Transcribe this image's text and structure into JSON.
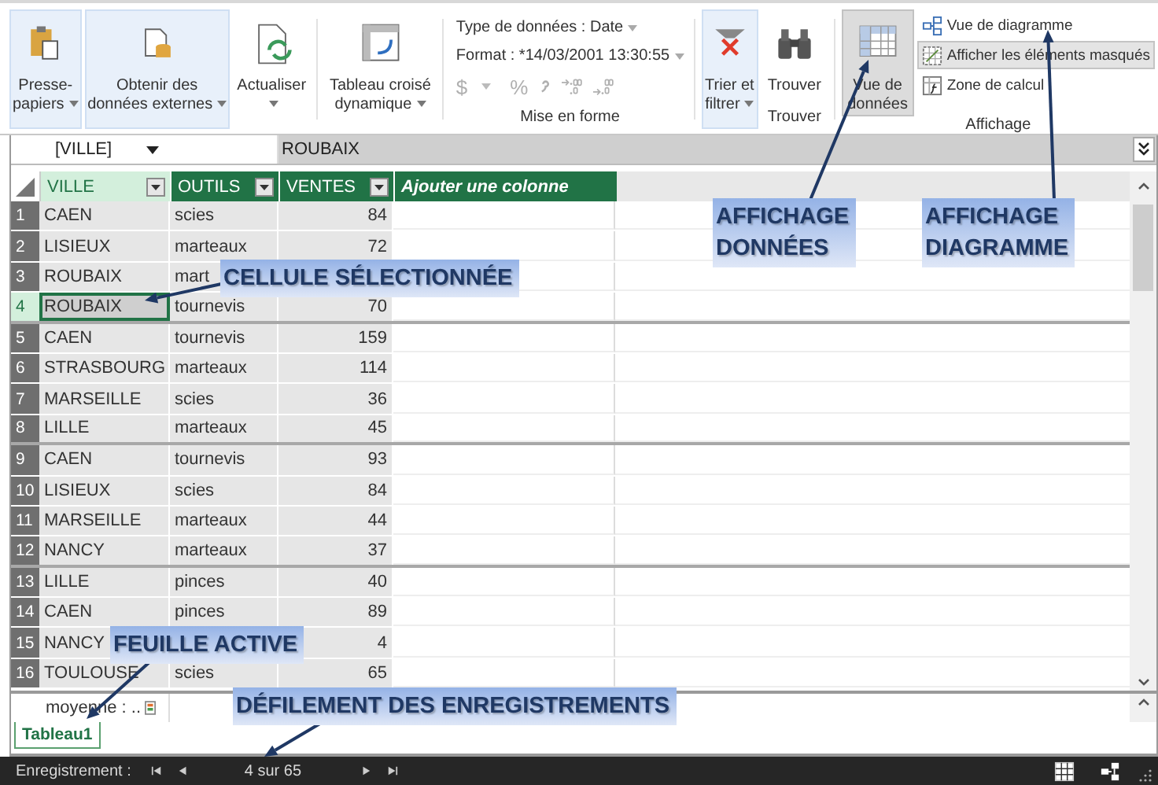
{
  "ribbon": {
    "clipboard": {
      "lines": [
        "Presse-",
        "papiers"
      ],
      "dropdown": true,
      "highlighted": true
    },
    "external_data": {
      "lines": [
        "Obtenir des",
        "données externes"
      ],
      "dropdown": true,
      "highlighted": true
    },
    "refresh": {
      "lines": [
        "Actualiser"
      ],
      "dropdown": true,
      "highlighted": false
    },
    "pivot": {
      "lines": [
        "Tableau croisé",
        "dynamique"
      ],
      "dropdown": true,
      "highlighted": false
    },
    "formatting": {
      "data_type": "Type de données : Date",
      "format": "Format : *14/03/2001 13:30:55",
      "currency": "$",
      "percent": "%",
      "disabled": true,
      "group_label": "Mise en forme"
    },
    "sort_filter": {
      "lines": [
        "Trier et",
        "filtrer"
      ],
      "dropdown": true,
      "highlighted": true
    },
    "find": {
      "lines": [
        "Trouver"
      ],
      "dropdown": false,
      "highlighted": false
    },
    "find_group_label": "Trouver",
    "data_view": {
      "lines": [
        "Vue de",
        "données"
      ],
      "selected": true
    },
    "view_options": [
      {
        "label": "Vue de diagramme",
        "selected": false
      },
      {
        "label": "Afficher les éléments masqués",
        "selected": true
      },
      {
        "label": "Zone de calcul",
        "selected": false
      }
    ],
    "view_group_label": "Affichage"
  },
  "formula_bar": {
    "name_box": "[VILLE]",
    "value": "ROUBAIX"
  },
  "table": {
    "columns": [
      {
        "label": "VILLE",
        "selected": true
      },
      {
        "label": "OUTILS",
        "selected": false
      },
      {
        "label": "VENTES",
        "selected": false
      }
    ],
    "add_column": "Ajouter une colonne",
    "rows": [
      {
        "num": "1",
        "ville": "CAEN",
        "outils": "scies",
        "ventes": "84",
        "selected": false
      },
      {
        "num": "2",
        "ville": "LISIEUX",
        "outils": "marteaux",
        "ventes": "72",
        "selected": false
      },
      {
        "num": "3",
        "ville": "ROUBAIX",
        "outils": "mart",
        "selected": false
      },
      {
        "num": "4",
        "ville": "ROUBAIX",
        "outils": "tournevis",
        "ventes": "70",
        "selected": true
      },
      {
        "num": "5",
        "ville": "CAEN",
        "outils": "tournevis",
        "ventes": "159",
        "selected": false
      },
      {
        "num": "6",
        "ville": "STRASBOURG",
        "outils": "marteaux",
        "ventes": "114",
        "selected": false
      },
      {
        "num": "7",
        "ville": "MARSEILLE",
        "outils": "scies",
        "ventes": "36",
        "selected": false
      },
      {
        "num": "8",
        "ville": "LILLE",
        "outils": "marteaux",
        "ventes": "45",
        "selected": false
      },
      {
        "num": "9",
        "ville": "CAEN",
        "outils": "tournevis",
        "ventes": "93",
        "selected": false
      },
      {
        "num": "10",
        "ville": "LISIEUX",
        "outils": "scies",
        "ventes": "84",
        "selected": false
      },
      {
        "num": "11",
        "ville": "MARSEILLE",
        "outils": "marteaux",
        "ventes": "44",
        "selected": false
      },
      {
        "num": "12",
        "ville": "NANCY",
        "outils": "marteaux",
        "ventes": "37",
        "selected": false
      },
      {
        "num": "13",
        "ville": "LILLE",
        "outils": "pinces",
        "ventes": "40",
        "selected": false
      },
      {
        "num": "14",
        "ville": "CAEN",
        "outils": "pinces",
        "ventes": "89",
        "selected": false
      },
      {
        "num": "15",
        "ville": "NANCY",
        "ventes": "4",
        "selected": false
      },
      {
        "num": "16",
        "ville": "TOULOUSE",
        "outils": "scies",
        "ventes": "65",
        "selected": false
      }
    ],
    "summary": "moyenne : .."
  },
  "sheet_tabs": [
    {
      "label": "Tableau1",
      "selected": true
    }
  ],
  "status_bar": {
    "label": "Enregistrement :",
    "position": "4 sur 65"
  },
  "callouts": [
    {
      "lines": [
        "CELLULE SÉLECTIONNÉE"
      ]
    },
    {
      "lines": [
        "AFFICHAGE",
        "DONNÉES"
      ]
    },
    {
      "lines": [
        "AFFICHAGE",
        "DIAGRAMME"
      ]
    },
    {
      "lines": [
        "FEUILLE ACTIVE"
      ]
    },
    {
      "lines": [
        "DÉFILEMENT DES ENREGISTREMENTS"
      ]
    }
  ]
}
